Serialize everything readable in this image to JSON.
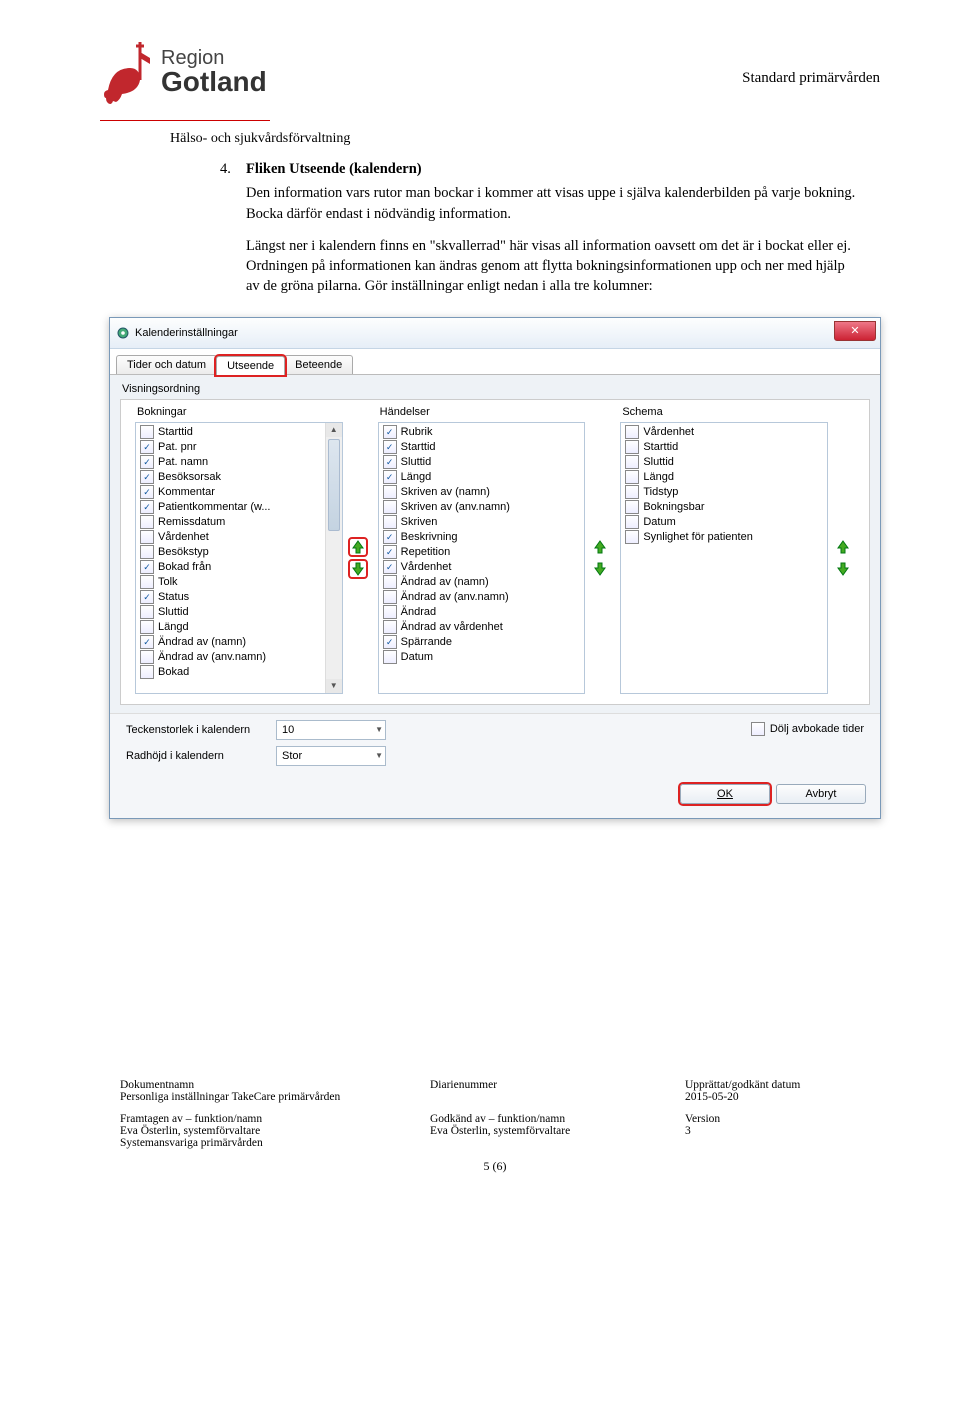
{
  "header": {
    "logo_region": "Region",
    "logo_gotland": "Gotland",
    "doc_title": "Standard primärvården"
  },
  "department": "Hälso- och sjukvårdsförvaltning",
  "section": {
    "number": "4.",
    "heading": "Fliken Utseende (kalendern)",
    "para1": "Den information vars rutor man bockar i kommer att visas uppe i själva kalenderbilden på varje bokning. Bocka därför endast i nödvändig information.",
    "para2": "Längst ner i kalendern finns en \"skvallerrad\" här visas all information oavsett om det är i bockat eller ej. Ordningen på informationen kan ändras genom att flytta bokningsinformationen upp och ner med hjälp av de gröna pilarna. Gör inställningar enligt nedan i alla tre kolumner:"
  },
  "dialog": {
    "title": "Kalenderinställningar",
    "tabs": [
      "Tider och datum",
      "Utseende",
      "Beteende"
    ],
    "active_tab": 1,
    "section_label": "Visningsordning",
    "columns": {
      "bokningar": {
        "header": "Bokningar",
        "items": [
          {
            "label": "Starttid",
            "checked": false
          },
          {
            "label": "Pat. pnr",
            "checked": true
          },
          {
            "label": "Pat. namn",
            "checked": true
          },
          {
            "label": "Besöksorsak",
            "checked": true
          },
          {
            "label": "Kommentar",
            "checked": true
          },
          {
            "label": "Patientkommentar (w...",
            "checked": true
          },
          {
            "label": "Remissdatum",
            "checked": false
          },
          {
            "label": "Vårdenhet",
            "checked": false
          },
          {
            "label": "Besökstyp",
            "checked": false
          },
          {
            "label": "Bokad från",
            "checked": true
          },
          {
            "label": "Tolk",
            "checked": false
          },
          {
            "label": "Status",
            "checked": true
          },
          {
            "label": "Sluttid",
            "checked": false
          },
          {
            "label": "Längd",
            "checked": false
          },
          {
            "label": "Ändrad av (namn)",
            "checked": true
          },
          {
            "label": "Ändrad av (anv.namn)",
            "checked": false
          },
          {
            "label": "Bokad",
            "checked": false
          }
        ]
      },
      "handelser": {
        "header": "Händelser",
        "items": [
          {
            "label": "Rubrik",
            "checked": true
          },
          {
            "label": "Starttid",
            "checked": true
          },
          {
            "label": "Sluttid",
            "checked": true
          },
          {
            "label": "Längd",
            "checked": true
          },
          {
            "label": "Skriven av (namn)",
            "checked": false
          },
          {
            "label": "Skriven av (anv.namn)",
            "checked": false
          },
          {
            "label": "Skriven",
            "checked": false
          },
          {
            "label": "Beskrivning",
            "checked": true
          },
          {
            "label": "Repetition",
            "checked": true
          },
          {
            "label": "Vårdenhet",
            "checked": true
          },
          {
            "label": "Ändrad av (namn)",
            "checked": false
          },
          {
            "label": "Ändrad av (anv.namn)",
            "checked": false
          },
          {
            "label": "Ändrad",
            "checked": false
          },
          {
            "label": "Ändrad av vårdenhet",
            "checked": false
          },
          {
            "label": "Spärrande",
            "checked": true
          },
          {
            "label": "Datum",
            "checked": false
          }
        ]
      },
      "schema": {
        "header": "Schema",
        "items": [
          {
            "label": "Vårdenhet",
            "checked": false
          },
          {
            "label": "Starttid",
            "checked": false
          },
          {
            "label": "Sluttid",
            "checked": false
          },
          {
            "label": "Längd",
            "checked": false
          },
          {
            "label": "Tidstyp",
            "checked": false
          },
          {
            "label": "Bokningsbar",
            "checked": false
          },
          {
            "label": "Datum",
            "checked": false
          },
          {
            "label": "Synlighet för patienten",
            "checked": false
          }
        ]
      }
    },
    "bottom": {
      "font_size_label": "Teckenstorlek i kalendern",
      "font_size_value": "10",
      "row_height_label": "Radhöjd i kalendern",
      "row_height_value": "Stor",
      "hide_cancelled": "Dölj avbokade tider"
    },
    "buttons": {
      "ok": "OK",
      "cancel": "Avbryt"
    }
  },
  "footer": {
    "col1": {
      "l1": "Dokumentnamn",
      "v1": "Personliga inställningar TakeCare primärvården",
      "l2": "Framtagen av – funktion/namn",
      "v2": "Eva Österlin, systemförvaltare",
      "v3": "Systemansvariga primärvården"
    },
    "col2": {
      "l1": "Diarienummer",
      "v1": "",
      "l2": "Godkänd av – funktion/namn",
      "v2": "Eva Österlin, systemförvaltare"
    },
    "col3": {
      "l1": "Upprättat/godkänt datum",
      "v1": "2015-05-20",
      "l2": "Version",
      "v2": "3"
    },
    "page": "5 (6)"
  }
}
